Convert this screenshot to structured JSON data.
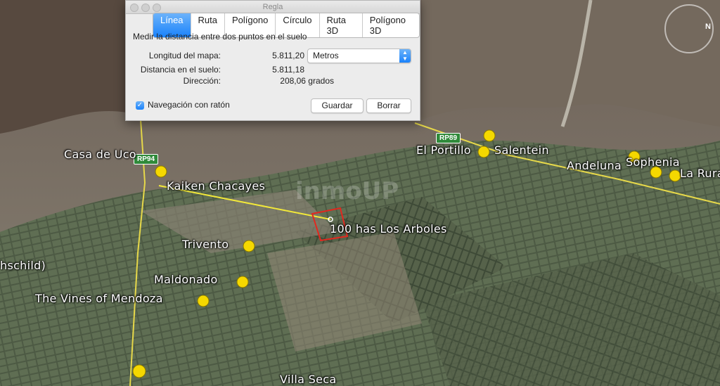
{
  "dialog": {
    "title": "Regla",
    "tabs": [
      "Línea",
      "Ruta",
      "Polígono",
      "Círculo",
      "Ruta 3D",
      "Polígono 3D"
    ],
    "description": "Medir la distancia entre dos puntos en el suelo",
    "map_length_label": "Longitud del mapa:",
    "map_length_value": "5.811,20",
    "unit_selected": "Metros",
    "ground_distance_label": "Distancia en el suelo:",
    "ground_distance_value": "5.811,18",
    "heading_label": "Dirección:",
    "heading_value": "208,06 grados",
    "mouse_nav_label": "Navegación con ratón",
    "mouse_nav_checked": true,
    "save_label": "Guardar",
    "clear_label": "Borrar"
  },
  "map": {
    "watermark": "inmoUP",
    "road_shields": [
      "RP94",
      "RP89"
    ],
    "places": [
      "Casa de Uco",
      "Kaiken Chacayes",
      "El Portillo",
      "Salentein",
      "Andeluna",
      "Sophenia",
      "La Rura",
      "100 has Los Arboles",
      "Trivento",
      "hschild)",
      "Maldonado",
      "The Vines of Mendoza",
      "Villa Seca"
    ],
    "compass_letter": "N",
    "colors": {
      "measure_line": "#f2e83a",
      "selection_box": "#e2281f",
      "pin": "#f5d800"
    }
  }
}
